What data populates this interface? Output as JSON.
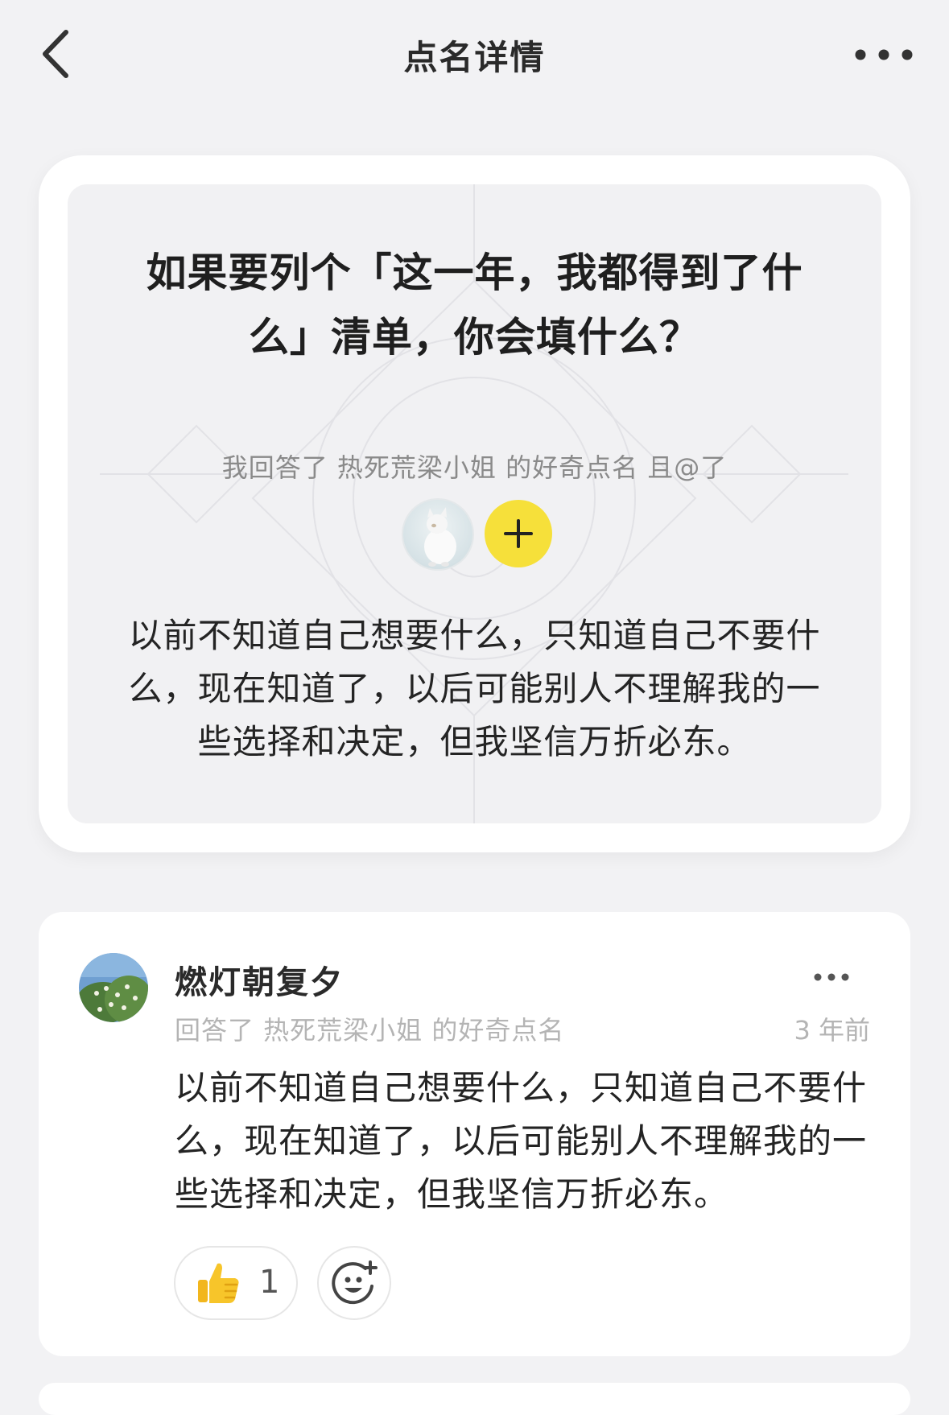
{
  "nav": {
    "title": "点名详情",
    "back_icon": "chevron-left-icon",
    "more_icon": "more-horizontal-icon"
  },
  "prompt_card": {
    "question": "如果要列个「这一年，我都得到了什么」清单，你会填什么？",
    "answered_line": "我回答了 热死荒梁小姐 的好奇点名 且@了",
    "mentioned_avatar": "white-cat-avatar",
    "add_icon": "plus-icon",
    "add_color": "#f6e03a",
    "answer": "以前不知道自己想要什么，只知道自己不要什么，现在知道了，以后可能别人不理解我的一些选择和决定，但我坚信万折必东。"
  },
  "comment": {
    "username": "燃灯朝复夕",
    "avatar": "flowering-tree-avatar",
    "subline": "回答了 热死荒梁小姐 的好奇点名",
    "time": "3 年前",
    "text": "以前不知道自己想要什么，只知道自己不要什么，现在知道了，以后可能别人不理解我的一些选择和决定，但我坚信万折必东。",
    "like_icon": "thumbs-up-icon",
    "like_count": "1",
    "emoji_icon": "add-emoji-icon"
  }
}
